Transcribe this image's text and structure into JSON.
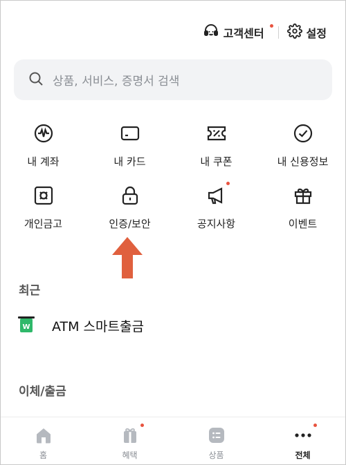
{
  "header": {
    "customer_center_label": "고객센터",
    "settings_label": "설정"
  },
  "search": {
    "placeholder": "상품, 서비스, 증명서 검색"
  },
  "menu": {
    "items": [
      {
        "label": "내 계좌",
        "icon": "account-icon"
      },
      {
        "label": "내 카드",
        "icon": "card-icon"
      },
      {
        "label": "내 쿠폰",
        "icon": "coupon-icon"
      },
      {
        "label": "내 신용정보",
        "icon": "credit-check-icon"
      },
      {
        "label": "개인금고",
        "icon": "safe-icon"
      },
      {
        "label": "인증/보안",
        "icon": "lock-icon"
      },
      {
        "label": "공지사항",
        "icon": "megaphone-icon"
      },
      {
        "label": "이벤트",
        "icon": "gift-icon"
      }
    ]
  },
  "recent": {
    "title": "최근",
    "items": [
      {
        "label": "ATM 스마트출금",
        "icon": "atm-icon"
      }
    ]
  },
  "transfer": {
    "title": "이체/출금"
  },
  "bottom_nav": {
    "tabs": [
      {
        "label": "홈",
        "icon": "home-icon"
      },
      {
        "label": "혜택",
        "icon": "benefit-icon"
      },
      {
        "label": "상품",
        "icon": "product-icon"
      },
      {
        "label": "전체",
        "icon": "more-icon"
      }
    ]
  },
  "colors": {
    "accent": "#e8533f",
    "arrow": "#e0603e",
    "icon_gray": "#b5b9bf",
    "atm_green": "#2fb86a"
  }
}
